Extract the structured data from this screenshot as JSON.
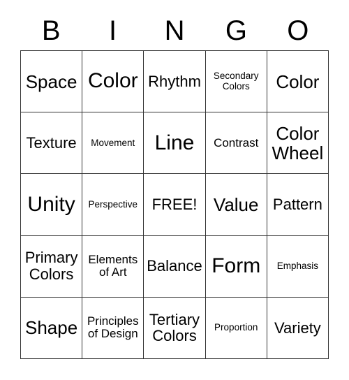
{
  "card": {
    "title_letters": [
      "B",
      "I",
      "N",
      "G",
      "O"
    ],
    "rows": [
      [
        {
          "label": "Space",
          "size": "lg"
        },
        {
          "label": "Color",
          "size": "xl"
        },
        {
          "label": "Rhythm",
          "size": "md"
        },
        {
          "label": "Secondary\nColors",
          "size": "xs"
        },
        {
          "label": "Color",
          "size": "lg"
        }
      ],
      [
        {
          "label": "Texture",
          "size": "md"
        },
        {
          "label": "Movement",
          "size": "xs"
        },
        {
          "label": "Line",
          "size": "xl"
        },
        {
          "label": "Contrast",
          "size": "sm"
        },
        {
          "label": "Color\nWheel",
          "size": "lg"
        }
      ],
      [
        {
          "label": "Unity",
          "size": "xl"
        },
        {
          "label": "Perspective",
          "size": "xs"
        },
        {
          "label": "FREE!",
          "size": "md"
        },
        {
          "label": "Value",
          "size": "lg"
        },
        {
          "label": "Pattern",
          "size": "md"
        }
      ],
      [
        {
          "label": "Primary\nColors",
          "size": "md"
        },
        {
          "label": "Elements\nof Art",
          "size": "sm"
        },
        {
          "label": "Balance",
          "size": "md"
        },
        {
          "label": "Form",
          "size": "xl"
        },
        {
          "label": "Emphasis",
          "size": "xs"
        }
      ],
      [
        {
          "label": "Shape",
          "size": "lg"
        },
        {
          "label": "Principles\nof Design",
          "size": "sm"
        },
        {
          "label": "Tertiary\nColors",
          "size": "md"
        },
        {
          "label": "Proportion",
          "size": "xs"
        },
        {
          "label": "Variety",
          "size": "md"
        }
      ]
    ],
    "free_space": "FREE!",
    "colors": {
      "background": "#ffffff",
      "text": "#000000",
      "grid_line": "#333333"
    }
  }
}
